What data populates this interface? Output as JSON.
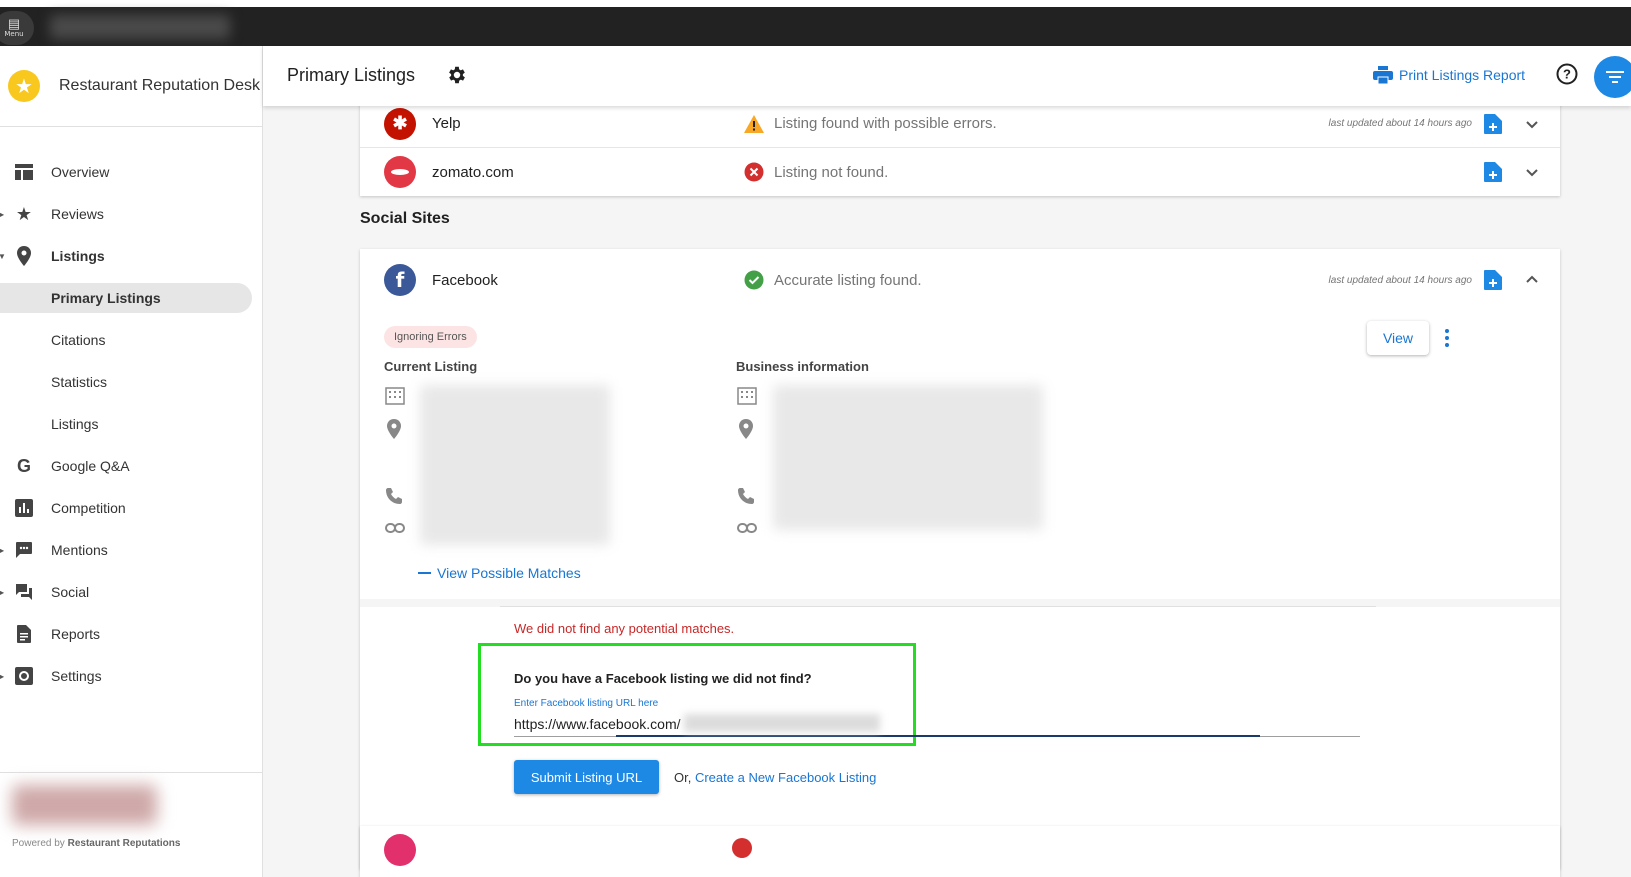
{
  "topbar": {
    "menu_label": "Menu"
  },
  "sidebar": {
    "brand_name": "Restaurant Reputation Desk",
    "items": [
      {
        "label": "Overview",
        "icon": "dashboard-icon"
      },
      {
        "label": "Reviews",
        "icon": "star-icon"
      },
      {
        "label": "Listings",
        "icon": "location-pin-icon"
      },
      {
        "label": "Primary Listings"
      },
      {
        "label": "Citations"
      },
      {
        "label": "Statistics"
      },
      {
        "label": "Listings"
      },
      {
        "label": "Google Q&A",
        "icon": "google-icon"
      },
      {
        "label": "Competition",
        "icon": "bar-chart-icon"
      },
      {
        "label": "Mentions",
        "icon": "chat-icon"
      },
      {
        "label": "Social",
        "icon": "forum-icon"
      },
      {
        "label": "Reports",
        "icon": "document-icon"
      },
      {
        "label": "Settings",
        "icon": "settings-icon"
      }
    ],
    "powered_prefix": "Powered by",
    "powered_brand": "Restaurant Reputations"
  },
  "header": {
    "title": "Primary Listings",
    "print_label": "Print Listings Report"
  },
  "listings": [
    {
      "site": "Yelp",
      "status": "Listing found with possible errors.",
      "status_type": "warning",
      "updated": "last updated about 14 hours ago",
      "logo_color": "#c41200"
    },
    {
      "site": "zomato.com",
      "status": "Listing not found.",
      "status_type": "error",
      "updated": "",
      "logo_color": "#e23744"
    }
  ],
  "social": {
    "section_title": "Social Sites",
    "facebook": {
      "site": "Facebook",
      "status": "Accurate listing found.",
      "updated": "last updated about 14 hours ago",
      "pill": "Ignoring Errors",
      "view_label": "View",
      "current_listing_title": "Current Listing",
      "business_info_title": "Business information",
      "view_matches_label": "View Possible Matches",
      "no_match_text": "We did not find any potential matches.",
      "question": "Do you have a Facebook listing we did not find?",
      "field_label": "Enter Facebook listing URL here",
      "field_value": "https://www.facebook.com/",
      "submit_label": "Submit Listing URL",
      "or_text": "Or,",
      "create_link": "Create a New Facebook Listing"
    }
  },
  "colors": {
    "accent": "#1976d2",
    "fab": "#1e88e5",
    "highlight_box": "#22dd22",
    "error": "#c62828",
    "success": "#43a047",
    "warning": "#f9a825"
  }
}
